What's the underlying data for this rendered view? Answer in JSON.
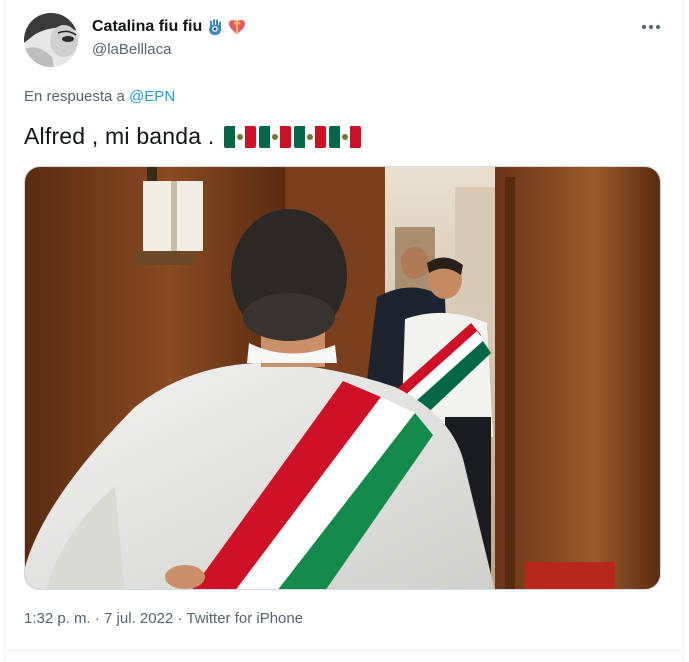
{
  "tweet": {
    "display_name": "Catalina fiu fiu",
    "name_emojis": [
      "hamsa-emoji",
      "heart-with-ribbon-emoji"
    ],
    "handle": "@laBelllaca",
    "reply_prefix": "En respuesta a",
    "reply_to": "@EPN",
    "text": "Alfred , mi banda .",
    "text_emojis": [
      "mexico-flag-emoji",
      "mexico-flag-emoji",
      "mexico-flag-emoji",
      "mexico-flag-emoji"
    ],
    "time": "1:32 p. m.",
    "separator": "·",
    "date": "7 jul. 2022",
    "source": "Twitter for iPhone"
  },
  "colors": {
    "text": "#0f1419",
    "secondary": "#536471",
    "link": "#1d9bf0",
    "divider": "#eff3f4",
    "flag_green": "#006847",
    "flag_red": "#ce1126"
  }
}
